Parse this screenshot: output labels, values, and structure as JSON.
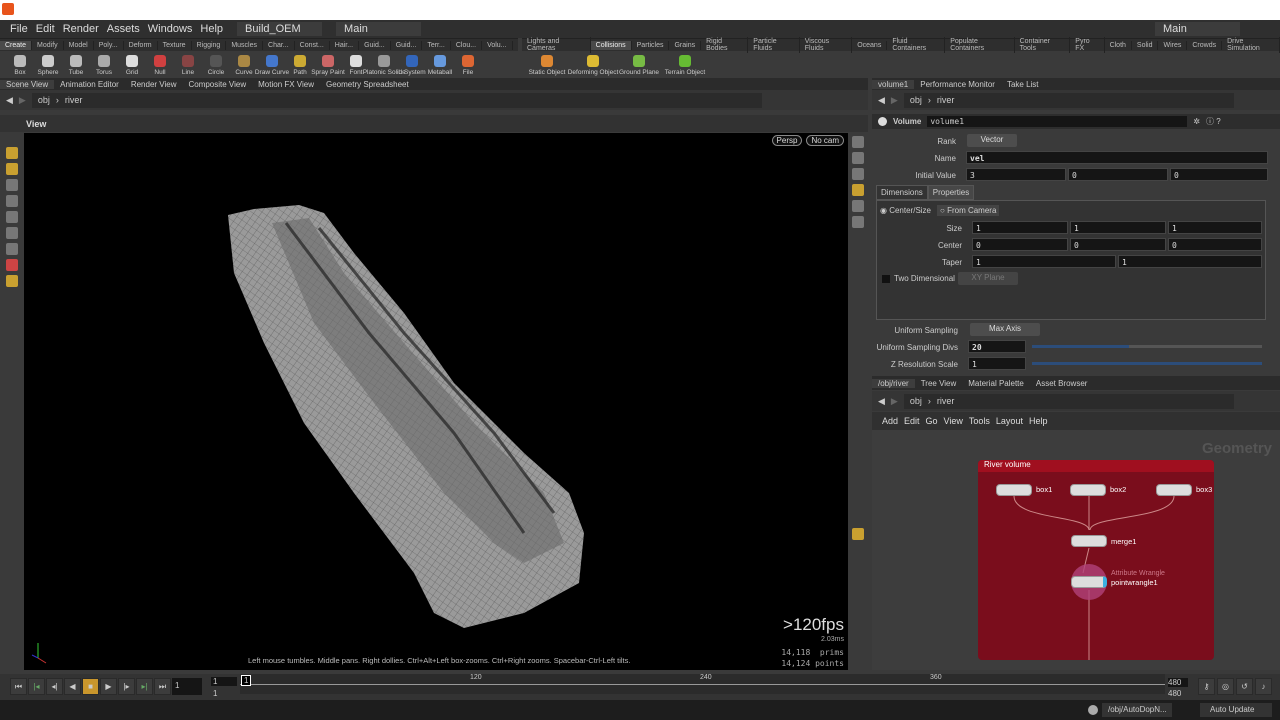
{
  "menubar": {
    "items": [
      "File",
      "Edit",
      "Render",
      "Assets",
      "Windows",
      "Help"
    ],
    "desktop": "Build_OEM",
    "context": "Main",
    "right_context": "Main"
  },
  "shelf_left": {
    "tabs": [
      "Create",
      "Modify",
      "Model",
      "Poly...",
      "Deform",
      "Texture",
      "Rigging",
      "Muscles",
      "Char...",
      "Const...",
      "Hair...",
      "Guid...",
      "Guid...",
      "Terr...",
      "Clou...",
      "Volu..."
    ],
    "tools": [
      {
        "label": "Box",
        "color": "#bbbbbb"
      },
      {
        "label": "Sphere",
        "color": "#cccccc"
      },
      {
        "label": "Tube",
        "color": "#bbbbbb"
      },
      {
        "label": "Torus",
        "color": "#aaaaaa"
      },
      {
        "label": "Grid",
        "color": "#dddddd"
      },
      {
        "label": "Null",
        "color": "#d04040"
      },
      {
        "label": "Line",
        "color": "#884444"
      },
      {
        "label": "Circle",
        "color": "#555555"
      },
      {
        "label": "Curve",
        "color": "#aa8844"
      },
      {
        "label": "Draw Curve",
        "color": "#4477cc"
      },
      {
        "label": "Path",
        "color": "#ccaa33"
      },
      {
        "label": "Spray Paint",
        "color": "#cc6666"
      },
      {
        "label": "Font",
        "color": "#dddddd"
      },
      {
        "label": "Platonic Solids",
        "color": "#999999"
      },
      {
        "label": "L-System",
        "color": "#3366bb"
      },
      {
        "label": "Metaball",
        "color": "#6699dd"
      },
      {
        "label": "File",
        "color": "#dd6633"
      }
    ]
  },
  "shelf_right": {
    "tabs": [
      "Lights and Cameras",
      "Collisions",
      "Particles",
      "Grains",
      "Rigid Bodies",
      "Particle Fluids",
      "Viscous Fluids",
      "Oceans",
      "Fluid Containers",
      "Populate Containers",
      "Container Tools",
      "Pyro FX",
      "Cloth",
      "Solid",
      "Wires",
      "Crowds",
      "Drive Simulation"
    ],
    "tools": [
      {
        "label": "Static Object",
        "color": "#dd8833"
      },
      {
        "label": "Deforming Object",
        "color": "#ddbb33"
      },
      {
        "label": "Ground Plane",
        "color": "#77bb44"
      },
      {
        "label": "Terrain Object",
        "color": "#66bb33"
      }
    ]
  },
  "left_pane": {
    "tabs": [
      "Scene View",
      "Animation Editor",
      "Render View",
      "Composite View",
      "Motion FX View",
      "Geometry Spreadsheet"
    ],
    "path": [
      "obj",
      "river"
    ],
    "view_title": "View",
    "persp": "Persp",
    "cam": "No cam",
    "fps": ">120fps",
    "ms": "2.03ms",
    "prims": "14,118  prims",
    "points": "14,124 points",
    "hint": "Left mouse tumbles. Middle pans. Right dollies. Ctrl+Alt+Left box-zooms. Ctrl+Right zooms. Spacebar-Ctrl-Left tilts."
  },
  "right_pane": {
    "tabs": [
      "volume1",
      "Performance Monitor",
      "Take List"
    ],
    "path": [
      "obj",
      "river"
    ]
  },
  "params": {
    "node_type": "Volume",
    "node_name": "volume1",
    "rank_label": "Rank",
    "rank": "Vector",
    "name_label": "Name",
    "name": "vel",
    "init_label": "Initial Value",
    "init": [
      "3",
      "0",
      "0"
    ],
    "tabs": [
      "Dimensions",
      "Properties"
    ],
    "radio": [
      "Center/Size",
      "From Camera"
    ],
    "size_label": "Size",
    "size": [
      "1",
      "1",
      "1"
    ],
    "center_label": "Center",
    "center": [
      "0",
      "0",
      "0"
    ],
    "taper_label": "Taper",
    "taper": [
      "1",
      "1"
    ],
    "twod_label": "Two Dimensional",
    "plane": "XY Plane",
    "us_label": "Uniform Sampling",
    "us": "Max Axis",
    "usd_label": "Uniform Sampling Divs",
    "usd": "20",
    "usd_fraction": 0.42,
    "zr_label": "Z Resolution Scale",
    "zr": "1"
  },
  "network": {
    "tabs": [
      "/obj/river",
      "Tree View",
      "Material Palette",
      "Asset Browser"
    ],
    "path": [
      "obj",
      "river"
    ],
    "menu": [
      "Add",
      "Edit",
      "Go",
      "View",
      "Tools",
      "Layout",
      "Help"
    ],
    "context_label": "Geometry",
    "box_title": "River volume",
    "box_color": "#7a0d1c",
    "nodes": [
      "box1",
      "box2",
      "box3",
      "merge1"
    ],
    "wrangle_type": "Attribute Wrangle",
    "wrangle_name": "pointwrangle1"
  },
  "timeline": {
    "frame": "1",
    "start": "1",
    "start2": "1",
    "marker": "1",
    "ticks": [
      "120",
      "240",
      "360"
    ],
    "end": "480",
    "end2": "480"
  },
  "status": {
    "dop": "/obj/AutoDopN...",
    "update": "Auto Update"
  }
}
